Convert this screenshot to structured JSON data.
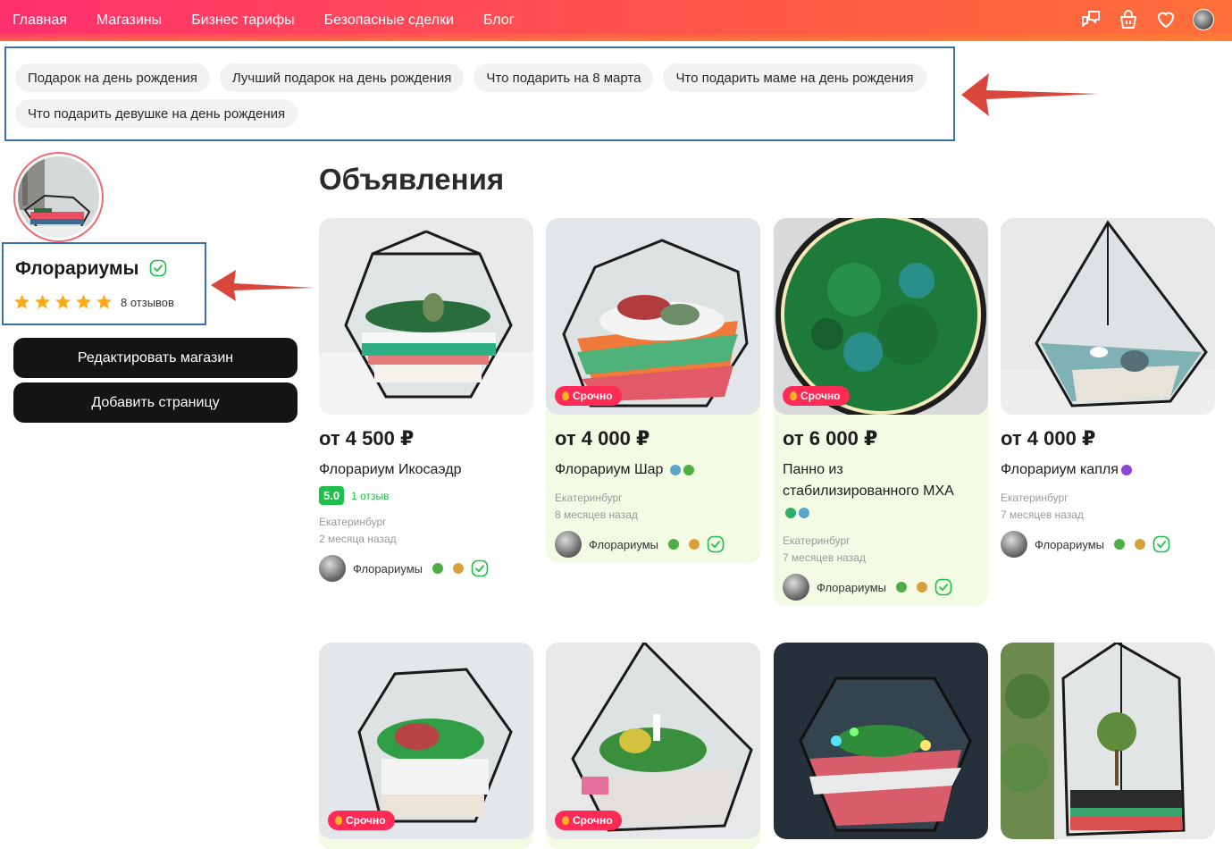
{
  "nav": {
    "items": [
      "Главная",
      "Магазины",
      "Бизнес тарифы",
      "Безопасные сделки",
      "Блог"
    ],
    "icons": [
      "chat-icon",
      "basket-icon",
      "heart-icon",
      "user-avatar"
    ]
  },
  "tags": [
    "Подарок на день рождения",
    "Лучший подарок на день рождения",
    "Что подарить на 8 марта",
    "Что подарить маме на день рождения",
    "Что подарить девушке на день рождения"
  ],
  "shop": {
    "name": "Флорариумы",
    "rating_stars": 5,
    "reviews": "8 отзывов",
    "edit_button": "Редактировать магазин",
    "add_page_button": "Добавить страницу"
  },
  "listings_title": "Объявления",
  "urgent_label": "Срочно",
  "cards": [
    {
      "price": "от 4 500 ₽",
      "title": "Флорариум Икосаэдр",
      "rating": "5.0",
      "rating_text": "1 отзыв",
      "city": "Екатеринбург",
      "time": "2 месяца назад",
      "seller": "Флорариумы",
      "urgent": false
    },
    {
      "price": "от 4 000 ₽",
      "title": "Флорариум Шар",
      "city": "Екатеринбург",
      "time": "8 месяцев назад",
      "seller": "Флорариумы",
      "urgent": true
    },
    {
      "price": "от 6 000 ₽",
      "title": "Панно из стабилизированного МХА",
      "city": "Екатеринбург",
      "time": "7 месяцев назад",
      "seller": "Флорариумы",
      "urgent": true
    },
    {
      "price": "от 4 000 ₽",
      "title": "Флорариум капля",
      "city": "Екатеринбург",
      "time": "7 месяцев назад",
      "seller": "Флорариумы",
      "urgent": false
    }
  ],
  "colors": {
    "header_gradient_start": "#ff2f6e",
    "header_gradient_end": "#ff6f3a",
    "button_dark": "#141414",
    "rating_green": "#1cc04a",
    "urgent_red": "#ff2a55",
    "promo_bg": "#f3fbe4",
    "highlight_box": "#3a6fb0",
    "arrow_red": "#d9473c"
  }
}
